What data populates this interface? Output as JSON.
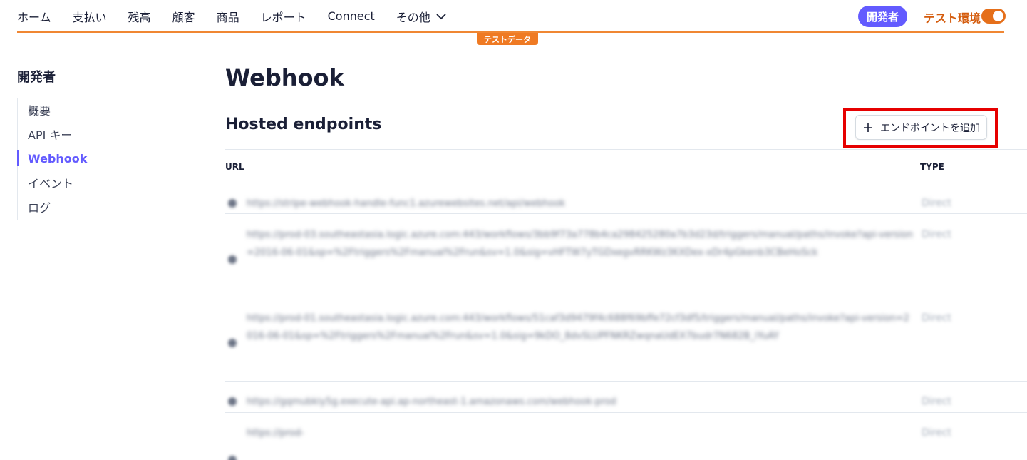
{
  "nav": {
    "items": [
      {
        "label": "ホーム"
      },
      {
        "label": "支払い"
      },
      {
        "label": "残高"
      },
      {
        "label": "顧客"
      },
      {
        "label": "商品"
      },
      {
        "label": "レポート"
      },
      {
        "label": "Connect"
      },
      {
        "label": "その他"
      }
    ],
    "developer_badge": "開発者",
    "test_env_label": "テスト環境",
    "test_env_on": true,
    "test_data_tab": "テストデータ"
  },
  "sidebar": {
    "title": "開発者",
    "items": [
      {
        "label": "概要",
        "active": false
      },
      {
        "label": "API キー",
        "active": false
      },
      {
        "label": "Webhook",
        "active": true
      },
      {
        "label": "イベント",
        "active": false
      },
      {
        "label": "ログ",
        "active": false
      }
    ]
  },
  "main": {
    "title": "Webhook",
    "section_title": "Hosted endpoints",
    "add_button_label": "エンドポイントを追加",
    "table": {
      "columns": [
        "URL",
        "TYPE"
      ],
      "rows": [
        {
          "url": "https://stripe-webhook-handle-func1.azurewebsites.net/api/webhook",
          "type": "Direct"
        },
        {
          "url": "https://prod-03.southeastasia.logic.azure.com:443/workflows/3bb9f73a778b4ca298425280a7b3d23d/triggers/manual/paths/invoke?api-version=2016-06-01&sp=%2Ftriggers%2Fmanual%2Frun&sv=1.0&sig=vHFTW7yTGDxegvRRKWz3KXDex-xDr4pGkenb3CBeHoSck",
          "type": "Direct"
        },
        {
          "url": "https://prod-01.southeastasia.logic.azure.com:443/workflows/51caf3d9479f4c688f69bffe72cf3df5/triggers/manual/paths/invoke?api-version=2016-06-01&sp=%2Ftriggers%2Fmanual%2Frun&sv=1.0&sig=9kDO_8dvSLUPFNKRZwqnaUdEX7budr7N682B_iYuAY",
          "type": "Direct"
        },
        {
          "url": "https://gqmubkiy5g.execute-api.ap-northeast-1.amazonaws.com/webhook-prod",
          "type": "Direct"
        },
        {
          "url": "https://prod-",
          "type": "Direct"
        }
      ]
    }
  }
}
